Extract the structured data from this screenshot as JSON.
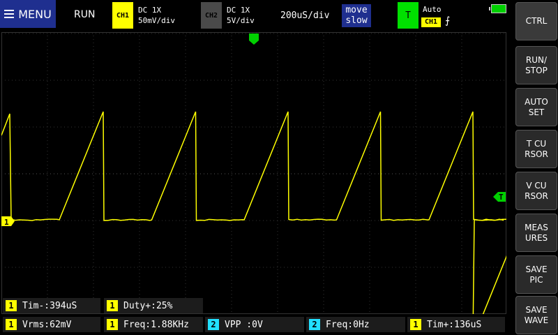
{
  "top": {
    "menu_label": "MENU",
    "run_state": "RUN",
    "ch1": {
      "tag": "CH1",
      "coupling": "DC  1X",
      "scale": "50mV/div",
      "color": "#ffff00"
    },
    "ch2": {
      "tag": "CH2",
      "coupling": "DC  1X",
      "scale": "5V/div",
      "color": "#4a4a4a"
    },
    "timebase": "200uS/div",
    "move_line1": "move",
    "move_line2": "slow",
    "trigger": {
      "tag": "T",
      "mode": "Auto",
      "source": "CH1",
      "edge": "⨍"
    }
  },
  "waveform": {
    "channel_marker": "1",
    "trigger_marker": "T",
    "color": "#ffff00"
  },
  "measurements": [
    {
      "ch": "1",
      "text": "Tim-:394uS"
    },
    {
      "ch": "1",
      "text": "Duty+:25%"
    },
    {
      "ch": "1",
      "text": "Vrms:62mV"
    },
    {
      "ch": "1",
      "text": "Freq:1.88KHz"
    },
    {
      "ch": "2",
      "text": "VPP :0V"
    },
    {
      "ch": "2",
      "text": "Freq:0Hz"
    },
    {
      "ch": "1",
      "text": "Tim+:136uS"
    }
  ],
  "side_buttons": [
    {
      "line1": "CTRL",
      "line2": ""
    },
    {
      "line1": "RUN/",
      "line2": "STOP"
    },
    {
      "line1": "AUTO",
      "line2": "SET"
    },
    {
      "line1": "T CU",
      "line2": "RSOR"
    },
    {
      "line1": "V CU",
      "line2": "RSOR"
    },
    {
      "line1": "MEAS",
      "line2": "URES"
    },
    {
      "line1": "SAVE",
      "line2": "PIC"
    },
    {
      "line1": "SAVE",
      "line2": "WAVE"
    }
  ]
}
